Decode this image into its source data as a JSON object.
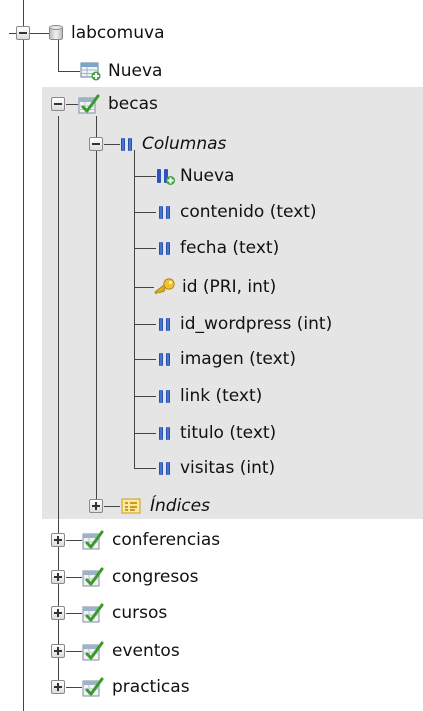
{
  "tree": {
    "database": {
      "name": "labcomuva",
      "new_label": "Nueva",
      "expanded_table": {
        "name": "becas",
        "columns_group": {
          "label": "Columnas",
          "new_label": "Nueva",
          "columns": [
            {
              "label": "contenido (text)",
              "icon": "column-icon"
            },
            {
              "label": "fecha (text)",
              "icon": "column-icon"
            },
            {
              "label": "id (PRI, int)",
              "icon": "primary-key-icon"
            },
            {
              "label": "id_wordpress (int)",
              "icon": "column-icon"
            },
            {
              "label": "imagen (text)",
              "icon": "column-icon"
            },
            {
              "label": "link (text)",
              "icon": "column-icon"
            },
            {
              "label": "titulo (text)",
              "icon": "column-icon"
            },
            {
              "label": "visitas (int)",
              "icon": "column-icon"
            }
          ]
        },
        "indexes_group": {
          "label": "Índices"
        }
      },
      "tables": [
        "conferencias",
        "congresos",
        "cursos",
        "eventos",
        "practicas"
      ]
    }
  },
  "colors": {
    "highlight": "#e5e5e5",
    "tree_line": "#444444",
    "column_blue": "#2a55c0",
    "table_green": "#3a9a2a",
    "key_gold": "#e0b020"
  }
}
